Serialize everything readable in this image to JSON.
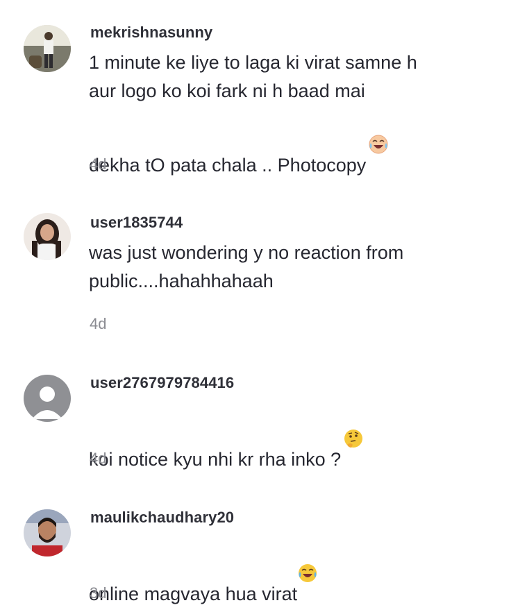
{
  "comments": [
    {
      "username": "mekrishnasunny",
      "text": "1 minute ke liye to laga ki virat samne h\naur logo ko koi fark ni h baad mai\ndekha tO pata chala .. Photocopy",
      "emoji": "face-with-tears-of-joy-emoji",
      "time": "4d",
      "avatar": "photo-avatar-man-standing"
    },
    {
      "username": "user1835744",
      "text": "was just wondering y no reaction from\npublic....hahahhahaah",
      "emoji": "",
      "time": "4d",
      "avatar": "photo-avatar-woman"
    },
    {
      "username": "user2767979784416",
      "text": "koi notice kyu nhi kr rha inko ?",
      "emoji": "thinking-face-emoji",
      "time": "4d",
      "avatar": "default-avatar-grey"
    },
    {
      "username": "maulikchaudhary20",
      "text": "online magvaya hua virat",
      "emoji": "face-with-tears-of-joy-emoji",
      "time": "3d",
      "avatar": "photo-avatar-man-beard"
    }
  ],
  "colors": {
    "username": "#2f3038",
    "text": "#262730",
    "time": "#8a8b91",
    "default_avatar_bg": "#8f9094"
  }
}
